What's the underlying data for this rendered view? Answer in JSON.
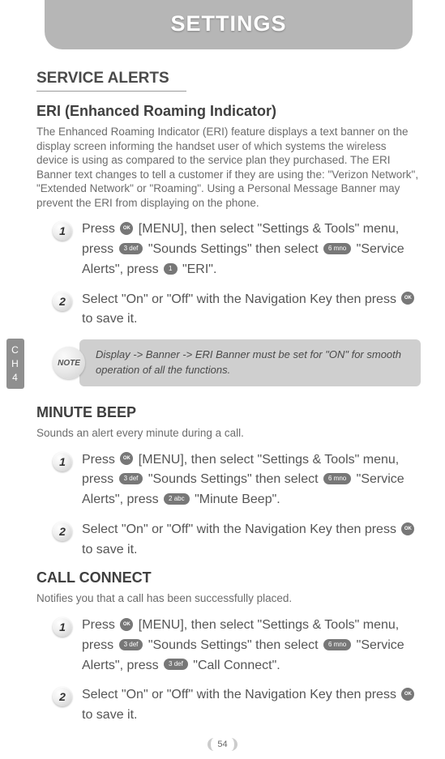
{
  "header": {
    "title": "SETTINGS"
  },
  "sideTab": {
    "line1": "C",
    "line2": "H",
    "line3": "4"
  },
  "pageNumber": "54",
  "sectionTitle": "SERVICE ALERTS",
  "keys": {
    "ok": "OK",
    "k1": "1 ",
    "k2": "2 abc",
    "k3": "3 def",
    "k6": "6 mno"
  },
  "eri": {
    "title": "ERI (Enhanced Roaming Indicator)",
    "desc": "The Enhanced Roaming Indicator (ERI) feature displays a text banner on the display screen informing the handset user of which systems the wireless device is using as compared to the service plan they purchased. The ERI Banner text changes to tell a customer if they are using the: \"Verizon Network\", \"Extended Network\" or \"Roaming\". Using a Personal Message Banner may prevent the ERI from displaying on the phone.",
    "steps": [
      {
        "num": "1",
        "parts": {
          "a": "Press ",
          "b": " [MENU], then select \"Settings & Tools\" menu, press ",
          "c": " \"Sounds Settings\" then select ",
          "d": " \"Service Alerts\", press ",
          "e": " \"ERI\"."
        }
      },
      {
        "num": "2",
        "parts": {
          "a": "Select \"On\" or \"Off\" with the Navigation Key then press ",
          "b": " to save it."
        }
      }
    ],
    "noteLabel": "NOTE",
    "noteText": "Display -> Banner -> ERI Banner must be set for \"ON\" for smooth operation of all the functions."
  },
  "minute": {
    "title": "MINUTE BEEP",
    "desc": "Sounds an alert every minute during a call.",
    "steps": [
      {
        "num": "1",
        "parts": {
          "a": "Press ",
          "b": " [MENU], then select \"Settings & Tools\" menu, press ",
          "c": " \"Sounds Settings\" then select ",
          "d": " \"Service Alerts\", press ",
          "e": " \"Minute Beep\"."
        }
      },
      {
        "num": "2",
        "parts": {
          "a": "Select \"On\" or \"Off\" with the Navigation Key then press ",
          "b": " to save it."
        }
      }
    ]
  },
  "call": {
    "title": "CALL CONNECT",
    "desc": "Notifies you that a call has been successfully placed.",
    "steps": [
      {
        "num": "1",
        "parts": {
          "a": "Press ",
          "b": " [MENU], then select \"Settings & Tools\" menu, press ",
          "c": " \"Sounds Settings\" then select ",
          "d": " \"Service Alerts\", press ",
          "e": " \"Call Connect\"."
        }
      },
      {
        "num": "2",
        "parts": {
          "a": "Select \"On\" or \"Off\" with the Navigation Key then press ",
          "b": " to save it."
        }
      }
    ]
  }
}
